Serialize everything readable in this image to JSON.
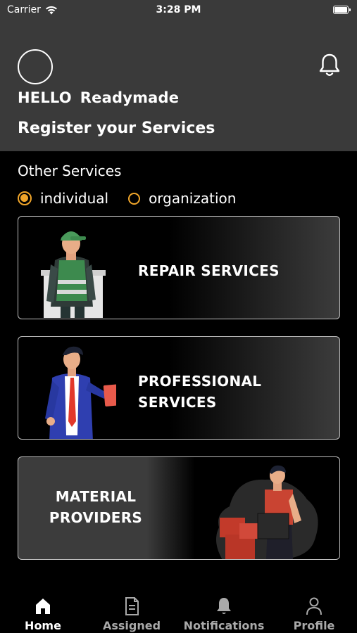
{
  "status_bar": {
    "carrier": "Carrier",
    "time": "3:28 PM"
  },
  "header": {
    "greeting": "HELLO",
    "username": "Readymade",
    "subtitle": "Register your Services"
  },
  "section_title": "Other Services",
  "service_type": {
    "options": [
      {
        "label": "individual",
        "selected": true
      },
      {
        "label": "organization",
        "selected": false
      }
    ]
  },
  "cards": [
    {
      "title_line1": "REPAIR SERVICES",
      "title_line2": ""
    },
    {
      "title_line1": "PROFESSIONAL",
      "title_line2": "SERVICES"
    },
    {
      "title_line1": "MATERIAL",
      "title_line2": "PROVIDERS"
    }
  ],
  "tabs": [
    {
      "label": "Home",
      "icon": "home-icon",
      "active": true
    },
    {
      "label": "Assigned",
      "icon": "document-icon",
      "active": false
    },
    {
      "label": "Notifications",
      "icon": "bell-icon",
      "active": false
    },
    {
      "label": "Profile",
      "icon": "person-icon",
      "active": false
    }
  ],
  "colors": {
    "accent": "#f0a52a",
    "header_bg": "#3a3a3a",
    "background": "#000000"
  }
}
